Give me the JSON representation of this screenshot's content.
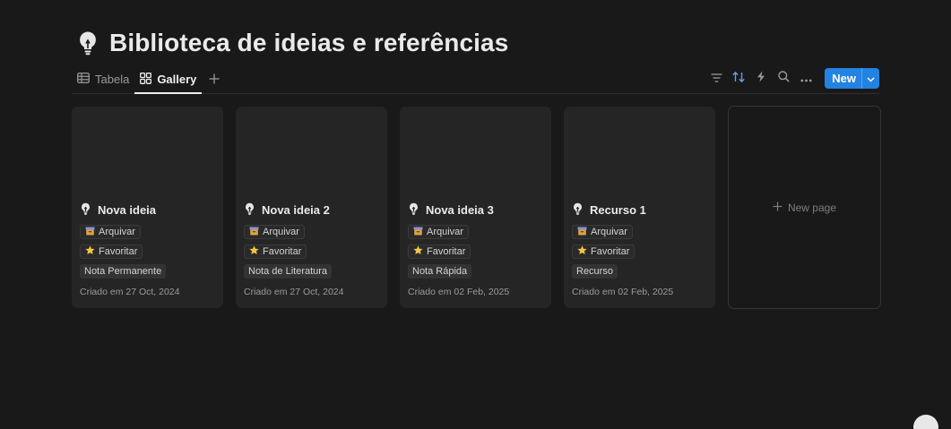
{
  "page": {
    "title": "Biblioteca de ideias e referências",
    "icon": "lightbulb-icon"
  },
  "views": {
    "tabs": [
      {
        "label": "Tabela",
        "icon": "table-icon",
        "active": false
      },
      {
        "label": "Gallery",
        "icon": "gallery-icon",
        "active": true
      }
    ],
    "add_icon": "plus-icon"
  },
  "toolbar": {
    "icons": [
      "filter-icon",
      "sort-icon",
      "automation-icon",
      "search-icon",
      "more-icon"
    ],
    "sort_active_color": "#5aa3f0",
    "new_label": "New",
    "new_button_color": "#2383e2"
  },
  "cards": [
    {
      "title": "Nova ideia",
      "archive": "Arquivar",
      "favorite": "Favoritar",
      "type": "Nota Permanente",
      "created": "Criado em 27 Oct, 2024"
    },
    {
      "title": "Nova ideia 2",
      "archive": "Arquivar",
      "favorite": "Favoritar",
      "type": "Nota de Literatura",
      "created": "Criado em 27 Oct, 2024"
    },
    {
      "title": "Nova ideia 3",
      "archive": "Arquivar",
      "favorite": "Favoritar",
      "type": "Nota Rápida",
      "created": "Criado em 02 Feb, 2025"
    },
    {
      "title": "Recurso 1",
      "archive": "Arquivar",
      "favorite": "Favoritar",
      "type": "Recurso",
      "created": "Criado em 02 Feb, 2025"
    }
  ],
  "new_page": {
    "label": "New page"
  }
}
